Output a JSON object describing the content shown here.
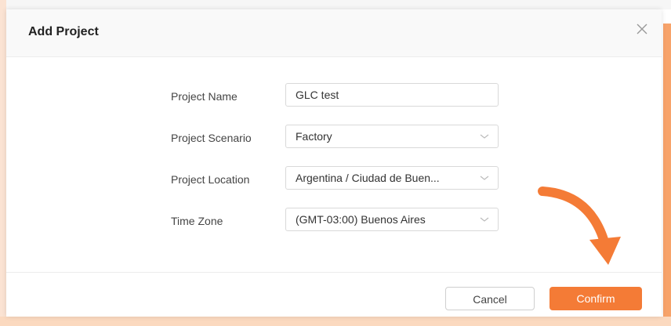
{
  "dialog": {
    "title": "Add Project",
    "close_icon": "close-icon"
  },
  "form": {
    "project_name": {
      "label": "Project Name",
      "value": "GLC test"
    },
    "project_scenario": {
      "label": "Project Scenario",
      "value": "Factory"
    },
    "project_location": {
      "label": "Project Location",
      "value": "Argentina / Ciudad de Buen..."
    },
    "time_zone": {
      "label": "Time Zone",
      "value": "(GMT-03:00) Buenos Aires"
    }
  },
  "footer": {
    "cancel_label": "Cancel",
    "confirm_label": "Confirm"
  },
  "colors": {
    "accent": "#f47b36",
    "arrow": "#f47b36"
  }
}
